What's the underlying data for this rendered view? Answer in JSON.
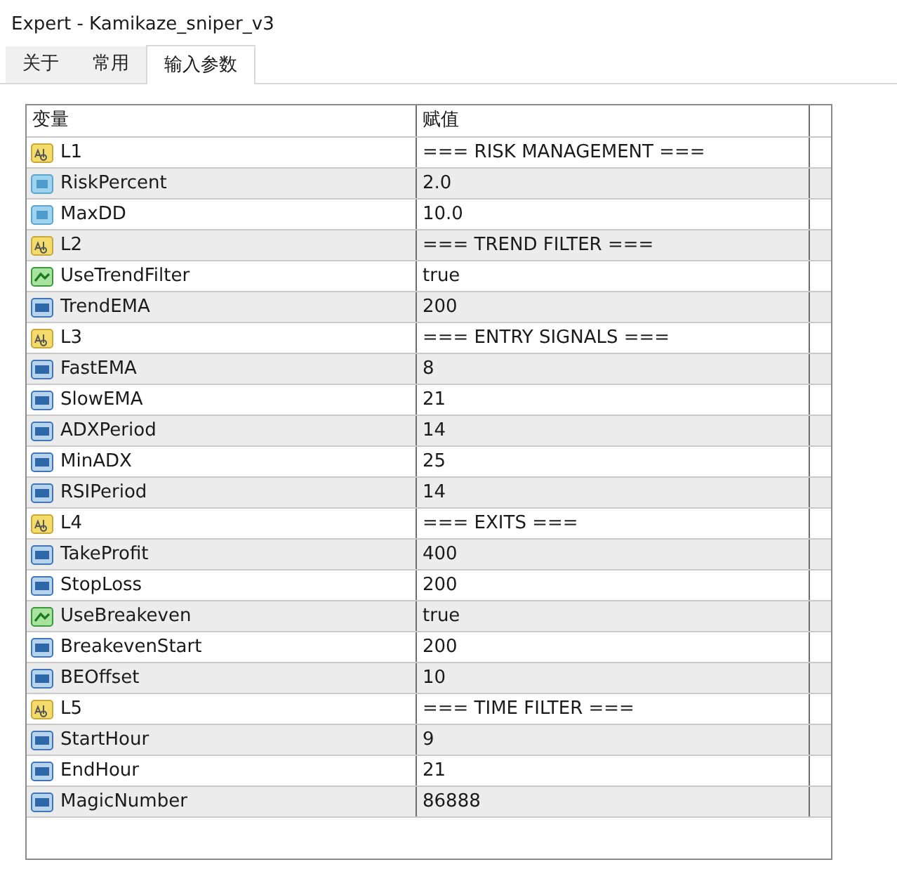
{
  "window": {
    "title": "Expert - Kamikaze_sniper_v3"
  },
  "tabs": [
    {
      "label": "关于",
      "selected": false
    },
    {
      "label": "常用",
      "selected": false
    },
    {
      "label": "输入参数",
      "selected": true
    }
  ],
  "table": {
    "columns": [
      "变量",
      "赋值"
    ],
    "rows": [
      {
        "kind": "string",
        "name": "L1",
        "value": "=== RISK MANAGEMENT ==="
      },
      {
        "kind": "double",
        "name": "RiskPercent",
        "value": "2.0"
      },
      {
        "kind": "double",
        "name": "MaxDD",
        "value": "10.0"
      },
      {
        "kind": "string",
        "name": "L2",
        "value": "=== TREND FILTER ==="
      },
      {
        "kind": "bool",
        "name": "UseTrendFilter",
        "value": "true"
      },
      {
        "kind": "int",
        "name": "TrendEMA",
        "value": "200"
      },
      {
        "kind": "string",
        "name": "L3",
        "value": "=== ENTRY SIGNALS ==="
      },
      {
        "kind": "int",
        "name": "FastEMA",
        "value": "8"
      },
      {
        "kind": "int",
        "name": "SlowEMA",
        "value": "21"
      },
      {
        "kind": "int",
        "name": "ADXPeriod",
        "value": "14"
      },
      {
        "kind": "int",
        "name": "MinADX",
        "value": "25"
      },
      {
        "kind": "int",
        "name": "RSIPeriod",
        "value": "14"
      },
      {
        "kind": "string",
        "name": "L4",
        "value": "=== EXITS ==="
      },
      {
        "kind": "int",
        "name": "TakeProfit",
        "value": "400"
      },
      {
        "kind": "int",
        "name": "StopLoss",
        "value": "200"
      },
      {
        "kind": "bool",
        "name": "UseBreakeven",
        "value": "true"
      },
      {
        "kind": "int",
        "name": "BreakevenStart",
        "value": "200"
      },
      {
        "kind": "int",
        "name": "BEOffset",
        "value": "10"
      },
      {
        "kind": "string",
        "name": "L5",
        "value": "=== TIME FILTER ==="
      },
      {
        "kind": "int",
        "name": "StartHour",
        "value": "9"
      },
      {
        "kind": "int",
        "name": "EndHour",
        "value": "21"
      },
      {
        "kind": "int",
        "name": "MagicNumber",
        "value": "86888"
      }
    ]
  }
}
